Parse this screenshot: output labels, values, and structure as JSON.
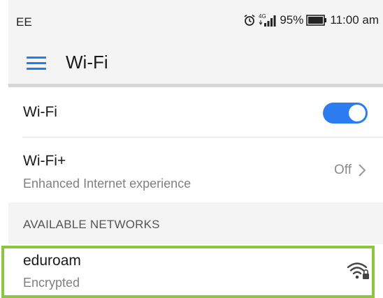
{
  "status_bar": {
    "carrier": "EE",
    "network_type": "4G",
    "battery": "95%",
    "time": "11:00 am",
    "icons": [
      "alarm-icon",
      "signal-icon",
      "battery-icon"
    ]
  },
  "app_bar": {
    "menu_icon": "hamburger-menu-icon",
    "title": "Wi-Fi"
  },
  "settings": {
    "wifi": {
      "label": "Wi-Fi",
      "enabled": true
    },
    "wifi_plus": {
      "label": "Wi-Fi+",
      "description": "Enhanced Internet experience",
      "value": "Off"
    }
  },
  "available_networks": {
    "header": "AVAILABLE NETWORKS",
    "items": [
      {
        "name": "eduroam",
        "security": "Encrypted",
        "icon": "wifi-locked-icon"
      }
    ]
  },
  "colors": {
    "accent": "#2b7cf0",
    "highlight": "#8cc63f",
    "background": "#f4f4f4"
  }
}
